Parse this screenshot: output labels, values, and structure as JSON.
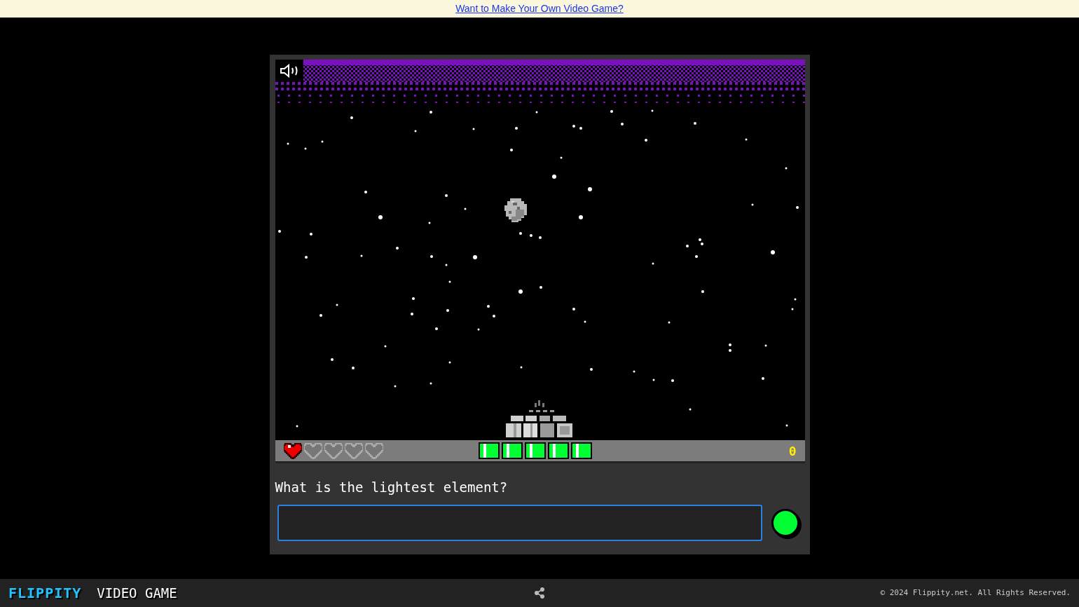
{
  "banner": {
    "link": "Want to Make Your Own Video Game?"
  },
  "game": {
    "sound_on": true,
    "hearts": [
      {
        "filled": true
      },
      {
        "filled": false
      },
      {
        "filled": false
      },
      {
        "filled": false
      },
      {
        "filled": false
      }
    ],
    "energy_cells": [
      {
        "full": true
      },
      {
        "full": true
      },
      {
        "full": true
      },
      {
        "full": true
      },
      {
        "full": true
      }
    ],
    "score": "0"
  },
  "question": {
    "text": "What is the lightest element?"
  },
  "footer": {
    "brand": "FLIPPITY",
    "product": "VIDEO GAME",
    "copyright": "© 2024 Flippity.net. All Rights Reserved."
  }
}
